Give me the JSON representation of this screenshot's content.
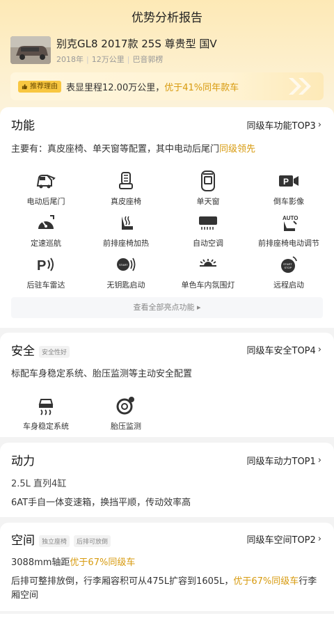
{
  "page": {
    "title": "优势分析报告"
  },
  "car": {
    "name": "别克GL8 2017款 25S 尊贵型 国V",
    "year": "2018年",
    "mileage": "12万公里",
    "location": "巴音郭楞"
  },
  "reason": {
    "tag": "推荐理由",
    "text": "表显里程12.00万公里，",
    "highlight": "优于41%同年款车"
  },
  "function_section": {
    "title": "功能",
    "more": "同级车功能TOP3",
    "desc_prefix": "主要有：真皮座椅、单天窗等配置，其中电动后尾门",
    "desc_highlight": "同级领先",
    "features": [
      {
        "label": "电动后尾门",
        "icon": "power-tailgate-icon"
      },
      {
        "label": "真皮座椅",
        "icon": "leather-seat-icon"
      },
      {
        "label": "单天窗",
        "icon": "sunroof-icon"
      },
      {
        "label": "倒车影像",
        "icon": "reverse-camera-icon"
      },
      {
        "label": "定速巡航",
        "icon": "cruise-control-icon"
      },
      {
        "label": "前排座椅加热",
        "icon": "seat-heating-icon"
      },
      {
        "label": "自动空调",
        "icon": "auto-ac-icon"
      },
      {
        "label": "前排座椅电动调节",
        "icon": "power-seat-icon"
      },
      {
        "label": "后驻车雷达",
        "icon": "parking-radar-icon"
      },
      {
        "label": "无钥匙启动",
        "icon": "keyless-start-icon"
      },
      {
        "label": "单色车内氛围灯",
        "icon": "ambient-light-icon"
      },
      {
        "label": "远程启动",
        "icon": "remote-start-icon"
      }
    ],
    "see_all": "查看全部亮点功能"
  },
  "safety_section": {
    "title": "安全",
    "badge": "安全性好",
    "more": "同级车安全TOP4",
    "desc": "标配车身稳定系统、胎压监测等主动安全配置",
    "features": [
      {
        "label": "车身稳定系统",
        "icon": "stability-control-icon"
      },
      {
        "label": "胎压监测",
        "icon": "tire-pressure-icon"
      }
    ]
  },
  "power_section": {
    "title": "动力",
    "more": "同级车动力TOP1",
    "line1": "2.5L 直列4缸",
    "line2": "6AT手自一体变速箱，换挡平顺，传动效率高"
  },
  "space_section": {
    "title": "空间",
    "badges": [
      "独立座椅",
      "后排可放倒"
    ],
    "more": "同级车空间TOP2",
    "line1_prefix": "3088mm轴距",
    "line1_highlight": "优于67%同级车",
    "line2_prefix": "后排可整排放倒，行李厢容积可从475L扩容到1605L，",
    "line2_highlight": "优于67%同级车",
    "line2_suffix": "行李",
    "line3": "厢空间"
  },
  "colors": {
    "accent": "#d79a0e",
    "tag": "#f8c741",
    "hero": "#fde9b6"
  }
}
